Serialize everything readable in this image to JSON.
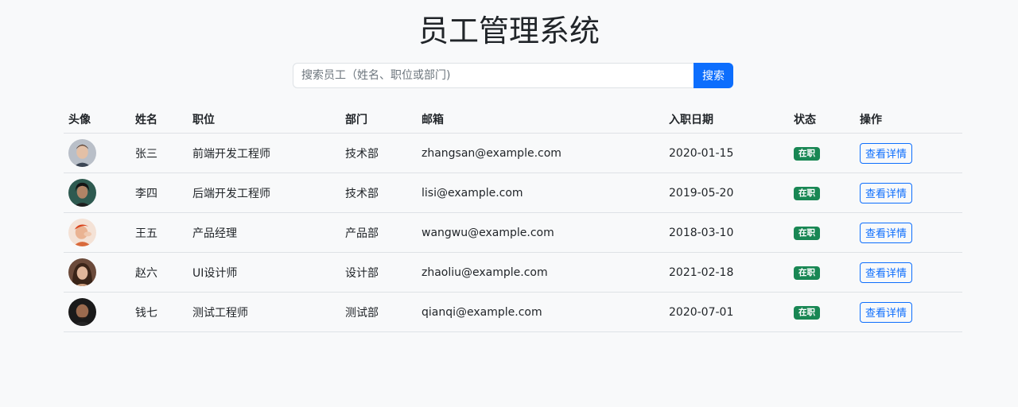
{
  "page": {
    "title": "员工管理系统"
  },
  "search": {
    "placeholder": "搜索员工（姓名、职位或部门)",
    "value": "",
    "button_label": "搜索"
  },
  "colors": {
    "primary": "#0d6efd",
    "success": "#198754",
    "border": "#dee2e6",
    "background": "#f8f9fa"
  },
  "table": {
    "headers": {
      "avatar": "头像",
      "name": "姓名",
      "position": "职位",
      "department": "部门",
      "email": "邮箱",
      "join_date": "入职日期",
      "status": "状态",
      "actions": "操作"
    },
    "rows": [
      {
        "avatar_icon": "avatar-photo",
        "name": "张三",
        "position": "前端开发工程师",
        "department": "技术部",
        "email": "zhangsan@example.com",
        "join_date": "2020-01-15",
        "status": "在职",
        "action_label": "查看详情"
      },
      {
        "avatar_icon": "avatar-photo",
        "name": "李四",
        "position": "后端开发工程师",
        "department": "技术部",
        "email": "lisi@example.com",
        "join_date": "2019-05-20",
        "status": "在职",
        "action_label": "查看详情"
      },
      {
        "avatar_icon": "avatar-photo",
        "name": "王五",
        "position": "产品经理",
        "department": "产品部",
        "email": "wangwu@example.com",
        "join_date": "2018-03-10",
        "status": "在职",
        "action_label": "查看详情"
      },
      {
        "avatar_icon": "avatar-photo",
        "name": "赵六",
        "position": "UI设计师",
        "department": "设计部",
        "email": "zhaoliu@example.com",
        "join_date": "2021-02-18",
        "status": "在职",
        "action_label": "查看详情"
      },
      {
        "avatar_icon": "avatar-photo",
        "name": "钱七",
        "position": "测试工程师",
        "department": "测试部",
        "email": "qianqi@example.com",
        "join_date": "2020-07-01",
        "status": "在职",
        "action_label": "查看详情"
      }
    ]
  }
}
